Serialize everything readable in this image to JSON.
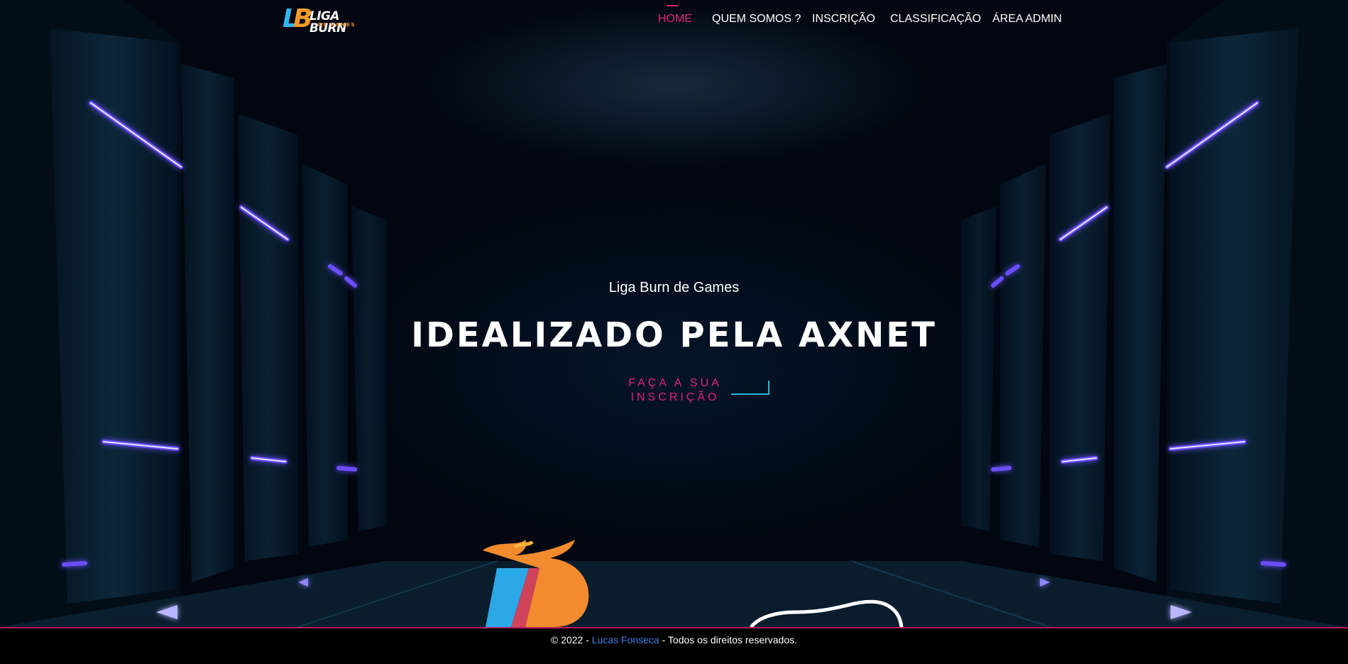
{
  "header": {
    "logo": {
      "text": "LIGA BURN",
      "subtext": "DE GAMES"
    },
    "nav": [
      {
        "label": "HOME",
        "active": true
      },
      {
        "label": "QUEM SOMOS ?",
        "active": false
      },
      {
        "label": "INSCRIÇÃO",
        "active": false
      },
      {
        "label": "CLASSIFICAÇÃO",
        "active": false
      },
      {
        "label": "ÁREA ADMIN",
        "active": false
      }
    ]
  },
  "hero": {
    "kicker": "Liga Burn de Games",
    "headline": "IDEALIZADO PELA AXNET",
    "cta_label": "FAÇA A SUA INSCRIÇÃO"
  },
  "footer": {
    "prefix": "© 2022 - ",
    "author": "Lucas Fonseca",
    "suffix": " - Todos os direitos reservados."
  },
  "colors": {
    "accent_pink": "#e0257a",
    "accent_cyan": "#22b7d6",
    "neon_blue": "#5a3cff",
    "link_blue": "#3b7fe8",
    "footer_border": "#b3195c"
  }
}
